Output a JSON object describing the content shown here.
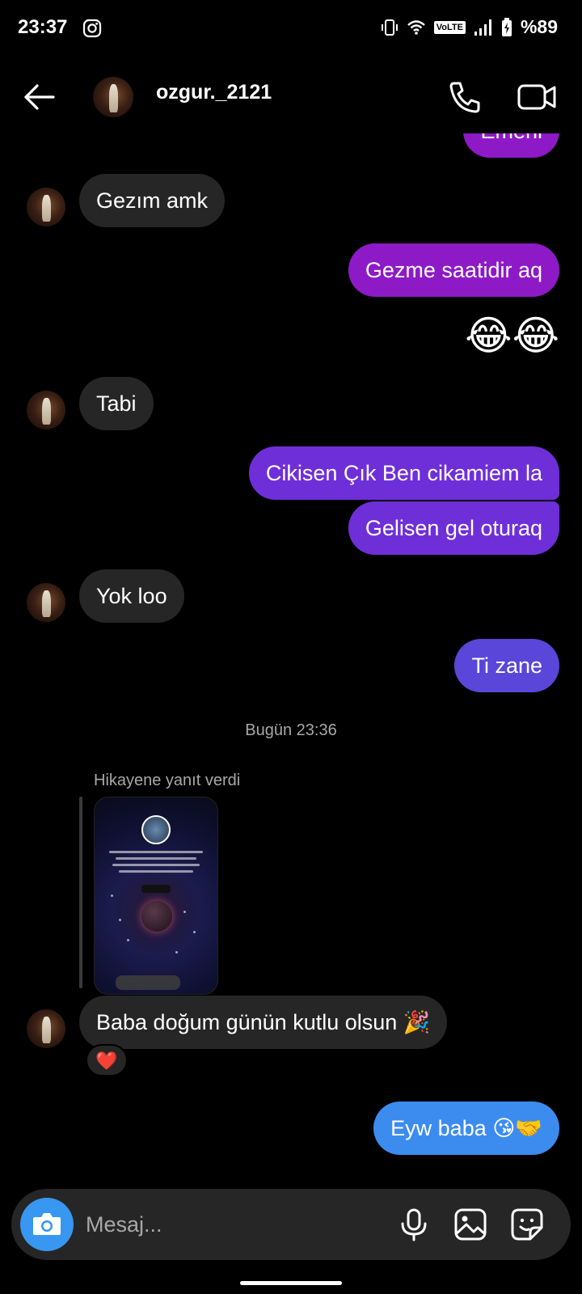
{
  "status": {
    "time": "23:37",
    "volte": "VoLTE",
    "battery": "%89"
  },
  "header": {
    "username": "ozgur._2121"
  },
  "messages": {
    "m0": "Emeni",
    "m1": "Gezım amk",
    "m2": "Gezme saatidir aq",
    "m3": "😂😂",
    "m4": "Tabi",
    "m5": "Cikisen Çık Ben cikamiem la",
    "m6": "Gelisen gel oturaq",
    "m7": "Yok loo",
    "m8": "Ti zane",
    "timestamp": "Bugün 23:36",
    "story_reply_label": "Hikayene yanıt verdi",
    "m9": "Baba doğum günün kutlu olsun 🎉",
    "m9_reaction": "❤️",
    "m10": "Eyw baba  😘🤝"
  },
  "composer": {
    "placeholder": "Mesaj..."
  },
  "colors": {
    "incoming": "#262626",
    "outgoing_top": "#8e1ac7",
    "outgoing_bottom": "#3c8cf0",
    "camera": "#3897f0"
  },
  "icons": [
    "back-arrow-icon",
    "phone-icon",
    "video-camera-icon",
    "camera-icon",
    "microphone-icon",
    "gallery-icon",
    "sticker-icon",
    "instagram-icon"
  ]
}
